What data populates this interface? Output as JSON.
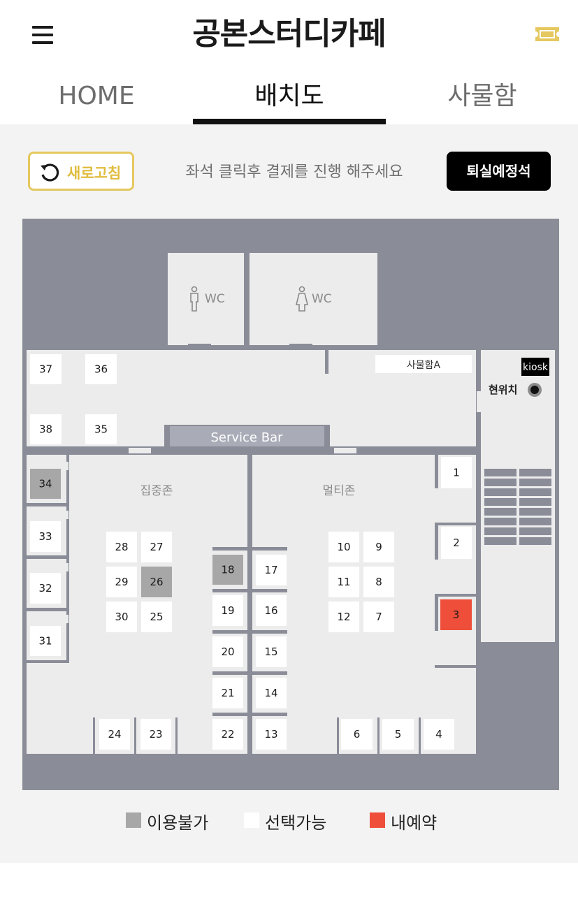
{
  "header": {
    "title": "공본스터디카페",
    "menu_icon": "hamburger-menu-icon",
    "ticket_icon": "ticket-icon",
    "accent_color": "#e5c85f"
  },
  "tabs": [
    {
      "label": "HOME",
      "active": false
    },
    {
      "label": "배치도",
      "active": true
    },
    {
      "label": "사물함",
      "active": false
    }
  ],
  "toolbar": {
    "refresh_label": "새로고침",
    "guide_text": "좌석 클릭후 결제를 진행 해주세요",
    "checkout_label": "퇴실예정석"
  },
  "map": {
    "wc_labels": [
      "WC",
      "WC"
    ],
    "locker_label": "사물함A",
    "kiosk_label": "kiosk",
    "current_location_label": "현위치",
    "service_bar_label": "Service Bar",
    "zones": [
      "집중존",
      "멀티존"
    ],
    "status_colors": {
      "unavailable": "#a7a7a7",
      "available": "#ffffff",
      "mine": "#ef4e3a"
    },
    "seats": [
      {
        "number": "1",
        "status": "available"
      },
      {
        "number": "2",
        "status": "available"
      },
      {
        "number": "3",
        "status": "mine"
      },
      {
        "number": "4",
        "status": "available"
      },
      {
        "number": "5",
        "status": "available"
      },
      {
        "number": "6",
        "status": "available"
      },
      {
        "number": "7",
        "status": "available"
      },
      {
        "number": "8",
        "status": "available"
      },
      {
        "number": "9",
        "status": "available"
      },
      {
        "number": "10",
        "status": "available"
      },
      {
        "number": "11",
        "status": "available"
      },
      {
        "number": "12",
        "status": "available"
      },
      {
        "number": "13",
        "status": "available"
      },
      {
        "number": "14",
        "status": "available"
      },
      {
        "number": "15",
        "status": "available"
      },
      {
        "number": "16",
        "status": "available"
      },
      {
        "number": "17",
        "status": "available"
      },
      {
        "number": "18",
        "status": "unavailable"
      },
      {
        "number": "19",
        "status": "available"
      },
      {
        "number": "20",
        "status": "available"
      },
      {
        "number": "21",
        "status": "available"
      },
      {
        "number": "22",
        "status": "available"
      },
      {
        "number": "23",
        "status": "available"
      },
      {
        "number": "24",
        "status": "available"
      },
      {
        "number": "25",
        "status": "available"
      },
      {
        "number": "26",
        "status": "unavailable"
      },
      {
        "number": "27",
        "status": "available"
      },
      {
        "number": "28",
        "status": "available"
      },
      {
        "number": "29",
        "status": "available"
      },
      {
        "number": "30",
        "status": "available"
      },
      {
        "number": "31",
        "status": "available"
      },
      {
        "number": "32",
        "status": "available"
      },
      {
        "number": "33",
        "status": "available"
      },
      {
        "number": "34",
        "status": "unavailable"
      },
      {
        "number": "35",
        "status": "available"
      },
      {
        "number": "36",
        "status": "available"
      },
      {
        "number": "37",
        "status": "available"
      },
      {
        "number": "38",
        "status": "available"
      }
    ]
  },
  "legend": [
    {
      "label": "이용불가",
      "status": "unavailable"
    },
    {
      "label": "선택가능",
      "status": "available"
    },
    {
      "label": "내예약",
      "status": "mine"
    }
  ]
}
